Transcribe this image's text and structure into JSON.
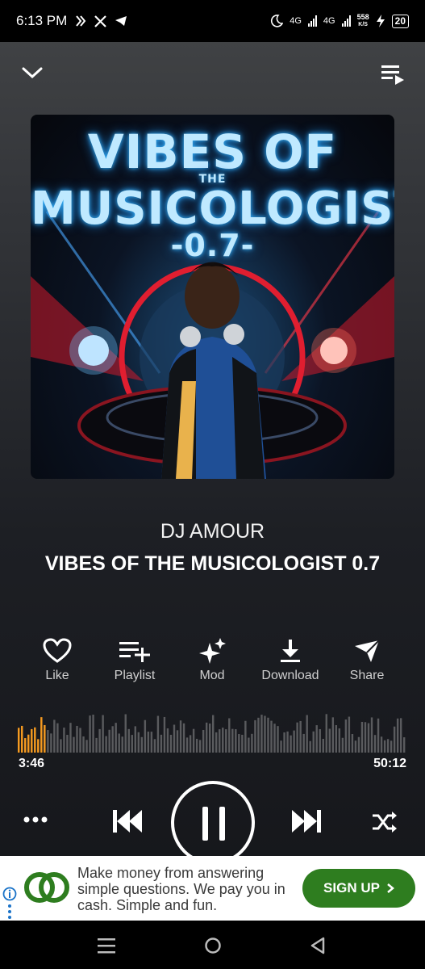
{
  "status_bar": {
    "time": "6:13 PM",
    "net1": "4G",
    "net2": "4G",
    "speed_value": "558",
    "speed_unit": "K/S",
    "battery": "20",
    "icons": [
      "messenger-icon",
      "x-icon",
      "telegram-icon",
      "moon-icon",
      "signal-icon",
      "signal-icon",
      "charging-icon",
      "battery-icon"
    ]
  },
  "topbar": {
    "collapse_icon": "chevron-down-icon",
    "queue_icon": "queue-icon"
  },
  "cover": {
    "line1": "VIBES OF",
    "line_the": "THE",
    "line2": "MUSICOLOGIST",
    "line3": "-0.7-"
  },
  "track": {
    "artist": "DJ AMOUR",
    "title": "VIBES OF THE MUSICOLOGIST 0.7"
  },
  "actions": [
    {
      "label": "Like",
      "icon": "heart-icon"
    },
    {
      "label": "Playlist",
      "icon": "playlist-add-icon"
    },
    {
      "label": "Mod",
      "icon": "sparkle-icon"
    },
    {
      "label": "Download",
      "icon": "download-icon"
    },
    {
      "label": "Share",
      "icon": "share-icon"
    }
  ],
  "progress": {
    "elapsed": "3:46",
    "total": "50:12",
    "fraction": 0.075
  },
  "colors": {
    "accent": "#f59a20",
    "waveform_inactive": "#5a5b5e",
    "ad_button": "#2e7d1f"
  },
  "controls": {
    "more_icon": "more-horizontal-icon",
    "prev_icon": "skip-previous-icon",
    "play_state_icon": "pause-icon",
    "next_icon": "skip-next-icon",
    "shuffle_icon": "shuffle-icon"
  },
  "ad": {
    "text": "Make money from answering simple questions. We pay you in cash. Simple and fun.",
    "button": "SIGN UP"
  },
  "navbar": [
    "menu-icon",
    "home-icon",
    "back-icon"
  ]
}
